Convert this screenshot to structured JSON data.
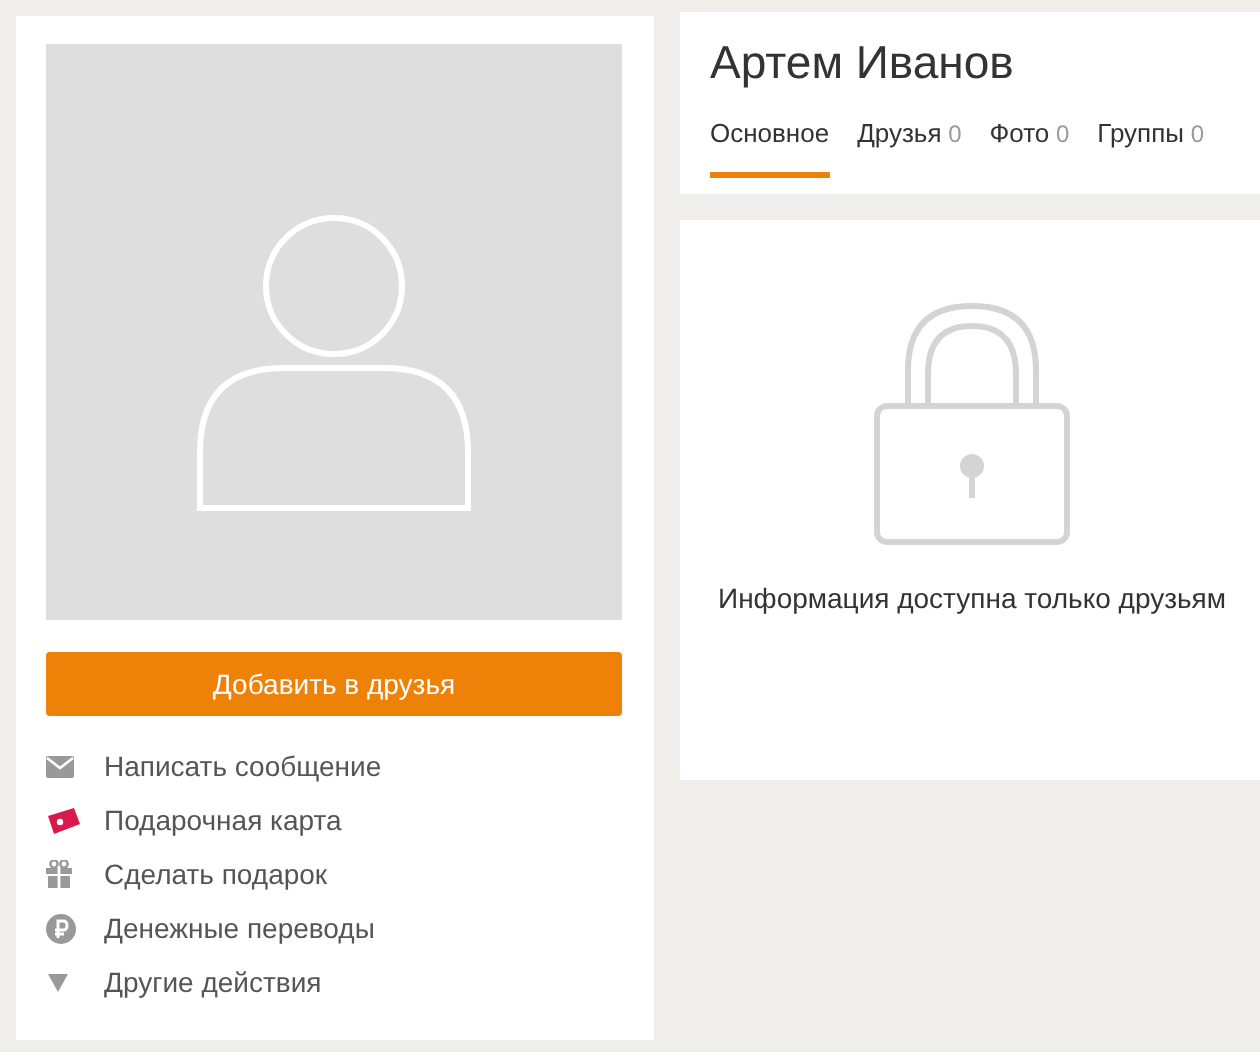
{
  "profile": {
    "name": "Артем Иванов",
    "add_button": "Добавить в друзья"
  },
  "actions": [
    {
      "kind": "message",
      "label": "Написать сообщение"
    },
    {
      "kind": "giftcard",
      "label": "Подарочная карта"
    },
    {
      "kind": "gift",
      "label": "Сделать подарок"
    },
    {
      "kind": "money",
      "label": "Денежные переводы"
    },
    {
      "kind": "more",
      "label": "Другие действия"
    }
  ],
  "tabs": [
    {
      "label": "Основное",
      "selected": true
    },
    {
      "label": "Друзья",
      "count": "0",
      "selected": false
    },
    {
      "label": "Фото",
      "count": "0",
      "selected": false
    },
    {
      "label": "Группы",
      "count": "0",
      "selected": false
    }
  ],
  "private_message": "Информация доступна только друзьям"
}
